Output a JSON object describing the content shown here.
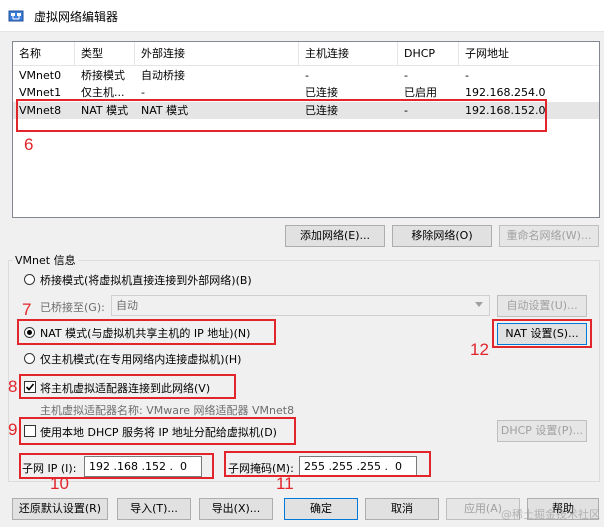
{
  "window": {
    "title": "虚拟网络编辑器"
  },
  "table": {
    "headers": [
      "名称",
      "类型",
      "外部连接",
      "主机连接",
      "DHCP",
      "子网地址"
    ],
    "rows": [
      [
        "VMnet0",
        "桥接模式",
        "自动桥接",
        "-",
        "-",
        "-"
      ],
      [
        "VMnet1",
        "仅主机...",
        "-",
        "已连接",
        "已启用",
        "192.168.254.0"
      ],
      [
        "VMnet8",
        "NAT 模式",
        "NAT 模式",
        "已连接",
        "-",
        "192.168.152.0"
      ]
    ]
  },
  "table_buttons": {
    "add": "添加网络(E)...",
    "remove": "移除网络(O)",
    "rename": "重命名网络(W)..."
  },
  "vmnet_info": {
    "label": "VMnet 信息",
    "bridged": "桥接模式(将虚拟机直接连接到外部网络)(B)",
    "bridged_to_label": "已桥接至(G):",
    "bridged_to_value": "自动",
    "auto_settings": "自动设置(U)...",
    "nat": "NAT 模式(与虚拟机共享主机的 IP 地址)(N)",
    "nat_settings": "NAT 设置(S)...",
    "host_only": "仅主机模式(在专用网络内连接虚拟机)(H)",
    "connect_adapter": "将主机虚拟适配器连接到此网络(V)",
    "adapter_name": "主机虚拟适配器名称: VMware 网络适配器 VMnet8",
    "use_dhcp": "使用本地 DHCP 服务将 IP 地址分配给虚拟机(D)",
    "dhcp_settings": "DHCP 设置(P)...",
    "subnet_ip_label": "子网 IP (I):",
    "subnet_ip": "192 .168 .152 .  0",
    "subnet_mask_label": "子网掩码(M):",
    "subnet_mask": "255 .255 .255 .  0"
  },
  "bottom_buttons": {
    "restore": "还原默认设置(R)",
    "import": "导入(T)...",
    "export": "导出(X)...",
    "ok": "确定",
    "cancel": "取消",
    "apply": "应用(A)",
    "help": "帮助"
  },
  "annotations": [
    "6",
    "7",
    "12",
    "8",
    "9",
    "10",
    "11"
  ],
  "watermark": "@稀土掘金技术社区",
  "colors": {
    "annotation": "#e2252b",
    "selected_row": "#e5e5e5",
    "default_button_border": "#0078d7"
  }
}
